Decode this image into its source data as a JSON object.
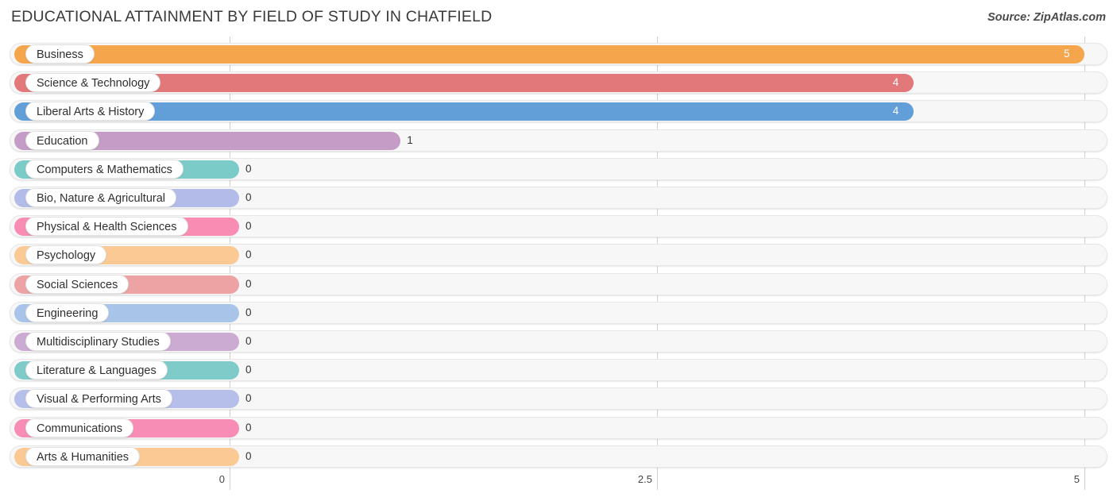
{
  "header": {
    "title": "EDUCATIONAL ATTAINMENT BY FIELD OF STUDY IN CHATFIELD",
    "source": "Source: ZipAtlas.com"
  },
  "chart_data": {
    "type": "bar",
    "orientation": "horizontal",
    "title": "EDUCATIONAL ATTAINMENT BY FIELD OF STUDY IN CHATFIELD",
    "xlabel": "",
    "ylabel": "",
    "xlim": [
      0,
      5
    ],
    "xticks": [
      "0",
      "2.5",
      "5"
    ],
    "xtick_values": [
      0,
      2.5,
      5
    ],
    "grid": true,
    "legend": "none",
    "categories": [
      "Business",
      "Science & Technology",
      "Liberal Arts & History",
      "Education",
      "Computers & Mathematics",
      "Bio, Nature & Agricultural",
      "Physical & Health Sciences",
      "Psychology",
      "Social Sciences",
      "Engineering",
      "Multidisciplinary Studies",
      "Literature & Languages",
      "Visual & Performing Arts",
      "Communications",
      "Arts & Humanities"
    ],
    "values": [
      5,
      4,
      4,
      1,
      0,
      0,
      0,
      0,
      0,
      0,
      0,
      0,
      0,
      0,
      0
    ],
    "value_labels": [
      "5",
      "4",
      "4",
      "1",
      "0",
      "0",
      "0",
      "0",
      "0",
      "0",
      "0",
      "0",
      "0",
      "0",
      "0"
    ],
    "colors": [
      "#f5a54c",
      "#e2787a",
      "#629ed8",
      "#c49cc6",
      "#7bcbc9",
      "#b3bce8",
      "#f98cb2",
      "#fbc993",
      "#eda3a3",
      "#a8c4e8",
      "#ccabd3",
      "#7ecbc9",
      "#b6bfe9",
      "#f78cb4",
      "#fbc993"
    ]
  },
  "rows": [
    {
      "label": "Business",
      "value_label": "5",
      "color": "#f5a54c"
    },
    {
      "label": "Science & Technology",
      "value_label": "4",
      "color": "#e2787a"
    },
    {
      "label": "Liberal Arts & History",
      "value_label": "4",
      "color": "#629ed8"
    },
    {
      "label": "Education",
      "value_label": "1",
      "color": "#c49cc6"
    },
    {
      "label": "Computers & Mathematics",
      "value_label": "0",
      "color": "#7bcbc9"
    },
    {
      "label": "Bio, Nature & Agricultural",
      "value_label": "0",
      "color": "#b3bce8"
    },
    {
      "label": "Physical & Health Sciences",
      "value_label": "0",
      "color": "#f98cb2"
    },
    {
      "label": "Psychology",
      "value_label": "0",
      "color": "#fbc993"
    },
    {
      "label": "Social Sciences",
      "value_label": "0",
      "color": "#eda3a3"
    },
    {
      "label": "Engineering",
      "value_label": "0",
      "color": "#a8c4e8"
    },
    {
      "label": "Multidisciplinary Studies",
      "value_label": "0",
      "color": "#ccabd3"
    },
    {
      "label": "Literature & Languages",
      "value_label": "0",
      "color": "#7ecbc9"
    },
    {
      "label": "Visual & Performing Arts",
      "value_label": "0",
      "color": "#b6bfe9"
    },
    {
      "label": "Communications",
      "value_label": "0",
      "color": "#f78cb4"
    },
    {
      "label": "Arts & Humanities",
      "value_label": "0",
      "color": "#fbc993"
    }
  ],
  "axis": {
    "ticks": [
      "0",
      "2.5",
      "5"
    ]
  }
}
